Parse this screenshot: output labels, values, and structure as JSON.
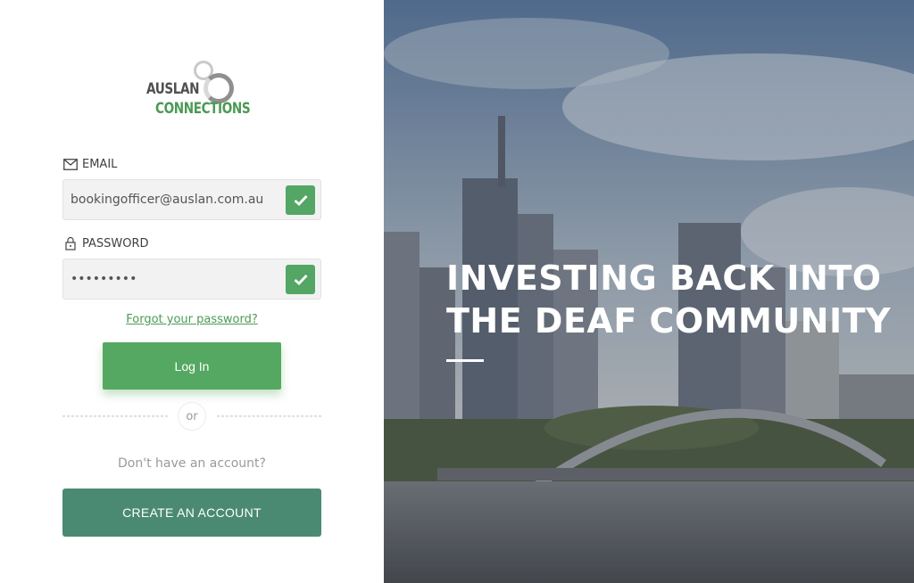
{
  "logo": {
    "line1": "AUSLAN",
    "line2": "CONNECTIONS"
  },
  "email": {
    "label": "EMAIL",
    "icon": "envelope-icon",
    "value": "bookingofficer@auslan.com.au"
  },
  "password": {
    "label": "PASSWORD",
    "icon": "lock-icon",
    "value": "•••••••••"
  },
  "forgot_link": "Forgot your password?",
  "login_label": "Log In",
  "or_text": "or",
  "no_account_text": "Don't have an account?",
  "create_label": "CREATE AN ACCOUNT",
  "hero": {
    "line1": "INVESTING BACK INTO",
    "line2": "THE DEAF COMMUNITY"
  },
  "colors": {
    "brand_green": "#55a862",
    "brand_teal": "#4a8a73",
    "link_green": "#4b9a55"
  }
}
